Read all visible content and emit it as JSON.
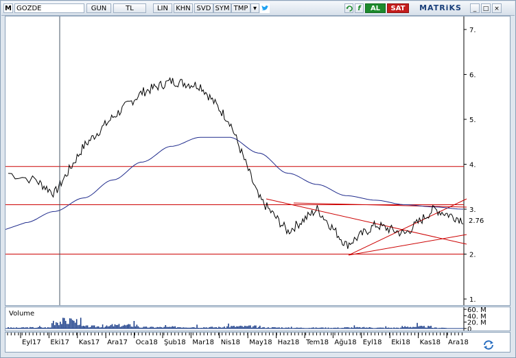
{
  "toolbar": {
    "logo": "M",
    "symbol": "GOZDE",
    "period": "GUN",
    "currency": "TL",
    "scale": "LIN",
    "buttons": [
      "KHN",
      "SVD",
      "SYM",
      "TMP"
    ],
    "refresh_icon": "refresh-icon",
    "formula_icon": "formula-icon",
    "buy_label": "AL",
    "sell_label": "SAT",
    "brand": "MATRiKS",
    "window_buttons": [
      "_",
      "□",
      "×"
    ]
  },
  "price_axis": {
    "ticks": [
      "7.",
      "6.",
      "5.",
      "4.",
      "3.",
      "2.",
      "1."
    ],
    "last_price": "2.76"
  },
  "volume_panel": {
    "label": "Volume",
    "ticks": [
      "60. M",
      "40. M",
      "20. M",
      "0"
    ]
  },
  "time_axis": {
    "months": [
      "Eyl17",
      "Eki17",
      "Kas17",
      "Ara17",
      "Oca18",
      "Şub18",
      "Mar18",
      "Nis18",
      "May18",
      "Haz18",
      "Tem18",
      "Ağu18",
      "Eyl18",
      "Eki18",
      "Kas18",
      "Ara18"
    ]
  },
  "colors": {
    "price": "#000000",
    "moving_average": "#1e2a8c",
    "support_resistance": "#cc0000",
    "volume": "#1d3f8a",
    "buy": "#1d8a2d",
    "sell": "#c41d1d"
  },
  "chart_data": {
    "type": "line",
    "title": "",
    "xlabel": "",
    "ylabel": "",
    "ylim": [
      1,
      7.2
    ],
    "x": [
      "Eyl17",
      "Eki17",
      "Kas17",
      "Ara17",
      "Oca18",
      "Şub18",
      "Mar18",
      "Nis18",
      "May18",
      "Haz18",
      "Tem18",
      "Ağu18",
      "Eyl18",
      "Eki18",
      "Kas18",
      "Ara18"
    ],
    "series": [
      {
        "values": [
          3.8,
          3.35,
          4.4,
          5.05,
          5.6,
          5.85,
          5.75,
          4.95,
          3.25,
          2.5,
          3.0,
          2.2,
          2.65,
          2.45,
          3.0,
          2.76
        ]
      },
      {
        "values": [
          2.7,
          2.95,
          3.25,
          3.65,
          4.05,
          4.4,
          4.6,
          4.6,
          4.25,
          3.8,
          3.55,
          3.3,
          3.2,
          3.1,
          3.05,
          3.0
        ]
      }
    ],
    "horizontal_lines": [
      3.95,
      3.1,
      2.0
    ],
    "volume_ylim": [
      0,
      60
    ],
    "volume_values": [
      3,
      4,
      28,
      8,
      12,
      5,
      6,
      5,
      8,
      4,
      3,
      3,
      4,
      3,
      7,
      3
    ]
  }
}
